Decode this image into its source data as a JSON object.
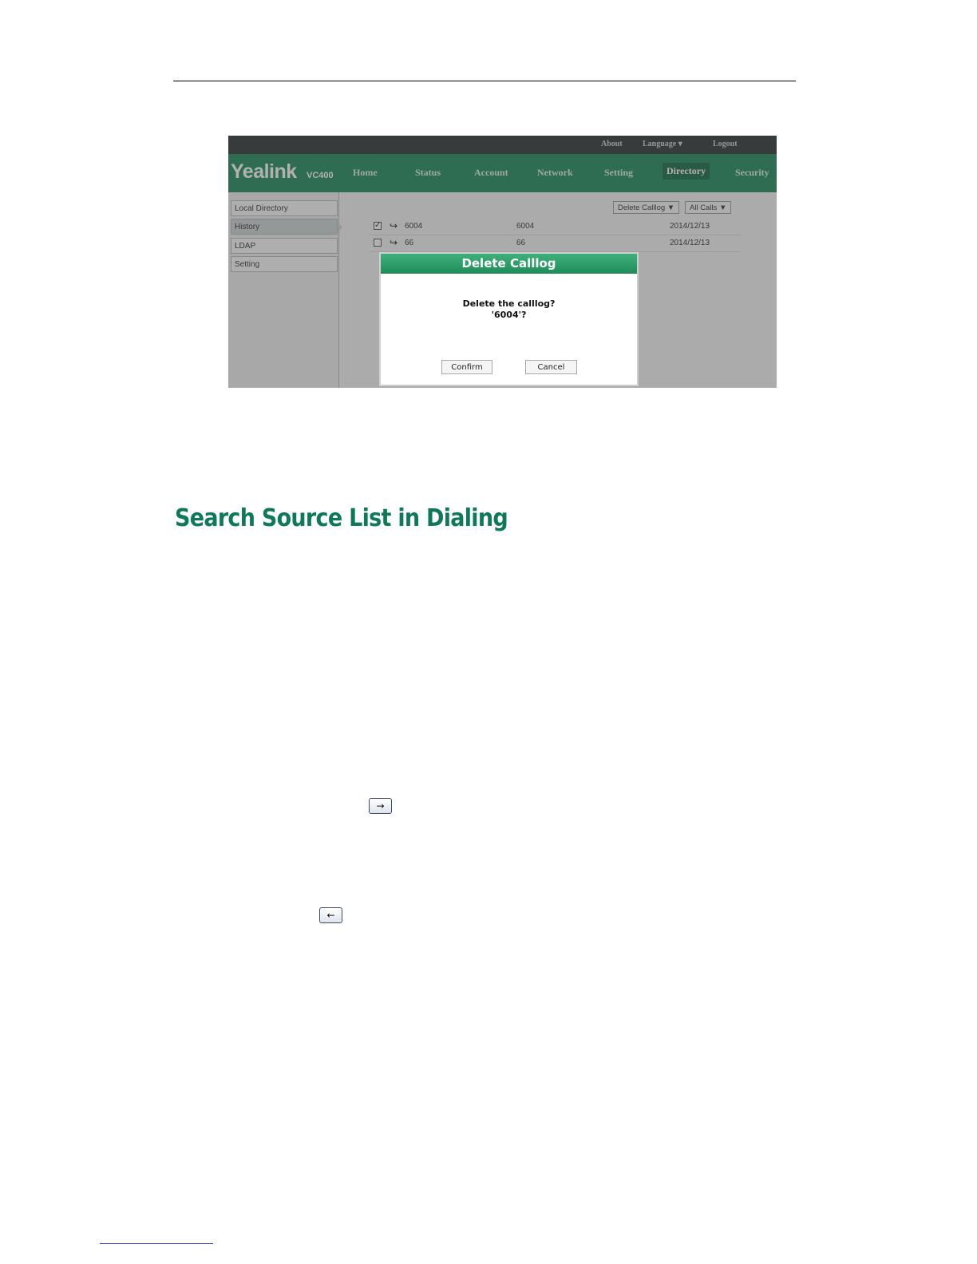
{
  "topbar": {
    "about": "About",
    "language": "Language ▾",
    "logout": "Logout"
  },
  "brand": {
    "logo": "Yealink",
    "model": "VC400"
  },
  "nav": [
    "Home",
    "Status",
    "Account",
    "Network",
    "Setting",
    "Directory",
    "Security"
  ],
  "nav_active": "Directory",
  "sidebar": [
    "Local Directory",
    "History",
    "LDAP",
    "Setting"
  ],
  "sidebar_selected": "History",
  "toolbar": {
    "delete": "Delete Calllog ▼",
    "filter": "All Calls ▼"
  },
  "rows": [
    {
      "checked": true,
      "check_mark": "✓",
      "name": "6004",
      "number": "6004",
      "date": "2014/12/13"
    },
    {
      "checked": false,
      "check_mark": "",
      "name": "66",
      "number": "66",
      "date": "2014/12/13"
    }
  ],
  "dialog": {
    "title": "Delete Calllog",
    "line1": "Delete the calllog?",
    "line2": "'6004'?",
    "confirm": "Confirm",
    "cancel": "Cancel"
  },
  "heading": "Search Source List in Dialing",
  "key_icons": {
    "right": "→",
    "left": "←"
  },
  "colors": {
    "brand_green": "#1e8a5c",
    "heading_green": "#0e7a55",
    "topbar": "#2e3436"
  }
}
